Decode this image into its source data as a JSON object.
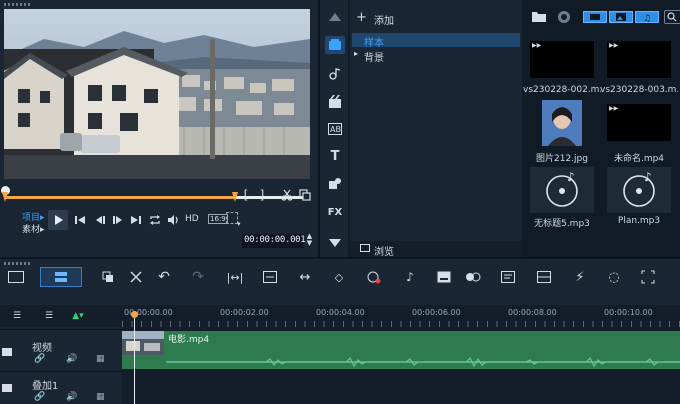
{
  "player": {
    "mode_project": "项目▸",
    "mode_clip": "素材▸",
    "hd_label": "HD",
    "aspect": "16:9",
    "timecode": "00:00:00.001"
  },
  "library": {
    "add_label": "添加",
    "tree_items": [
      {
        "label": "样本",
        "selected": true
      },
      {
        "label": "背景",
        "selected": false
      }
    ],
    "browse_label": "浏览",
    "fx_label": "FX",
    "media": [
      {
        "name": "vs230228-002.m...",
        "kind": "video"
      },
      {
        "name": "vs230228-003.m...",
        "kind": "video"
      },
      {
        "name": "图片212.jpg",
        "kind": "image"
      },
      {
        "name": "未命名.mp4",
        "kind": "video"
      },
      {
        "name": "无标题5.mp3",
        "kind": "audio"
      },
      {
        "name": "Plan.mp3",
        "kind": "audio"
      }
    ]
  },
  "timeline": {
    "ruler_labels": [
      "00:00:00.00",
      "00:00:02.00",
      "00:00:04.00",
      "00:00:06.00",
      "00:00:08.00",
      "00:00:10.00"
    ],
    "tracks": [
      {
        "name": "视频"
      },
      {
        "name": "叠加1"
      }
    ],
    "clip_name": "电影.mp4"
  },
  "colors": {
    "accent": "#2f8fe6",
    "clip_green": "#2e7b4e",
    "panel": "#1b2634",
    "background": "#0e1621",
    "scrubber_range": "#f4a640"
  }
}
